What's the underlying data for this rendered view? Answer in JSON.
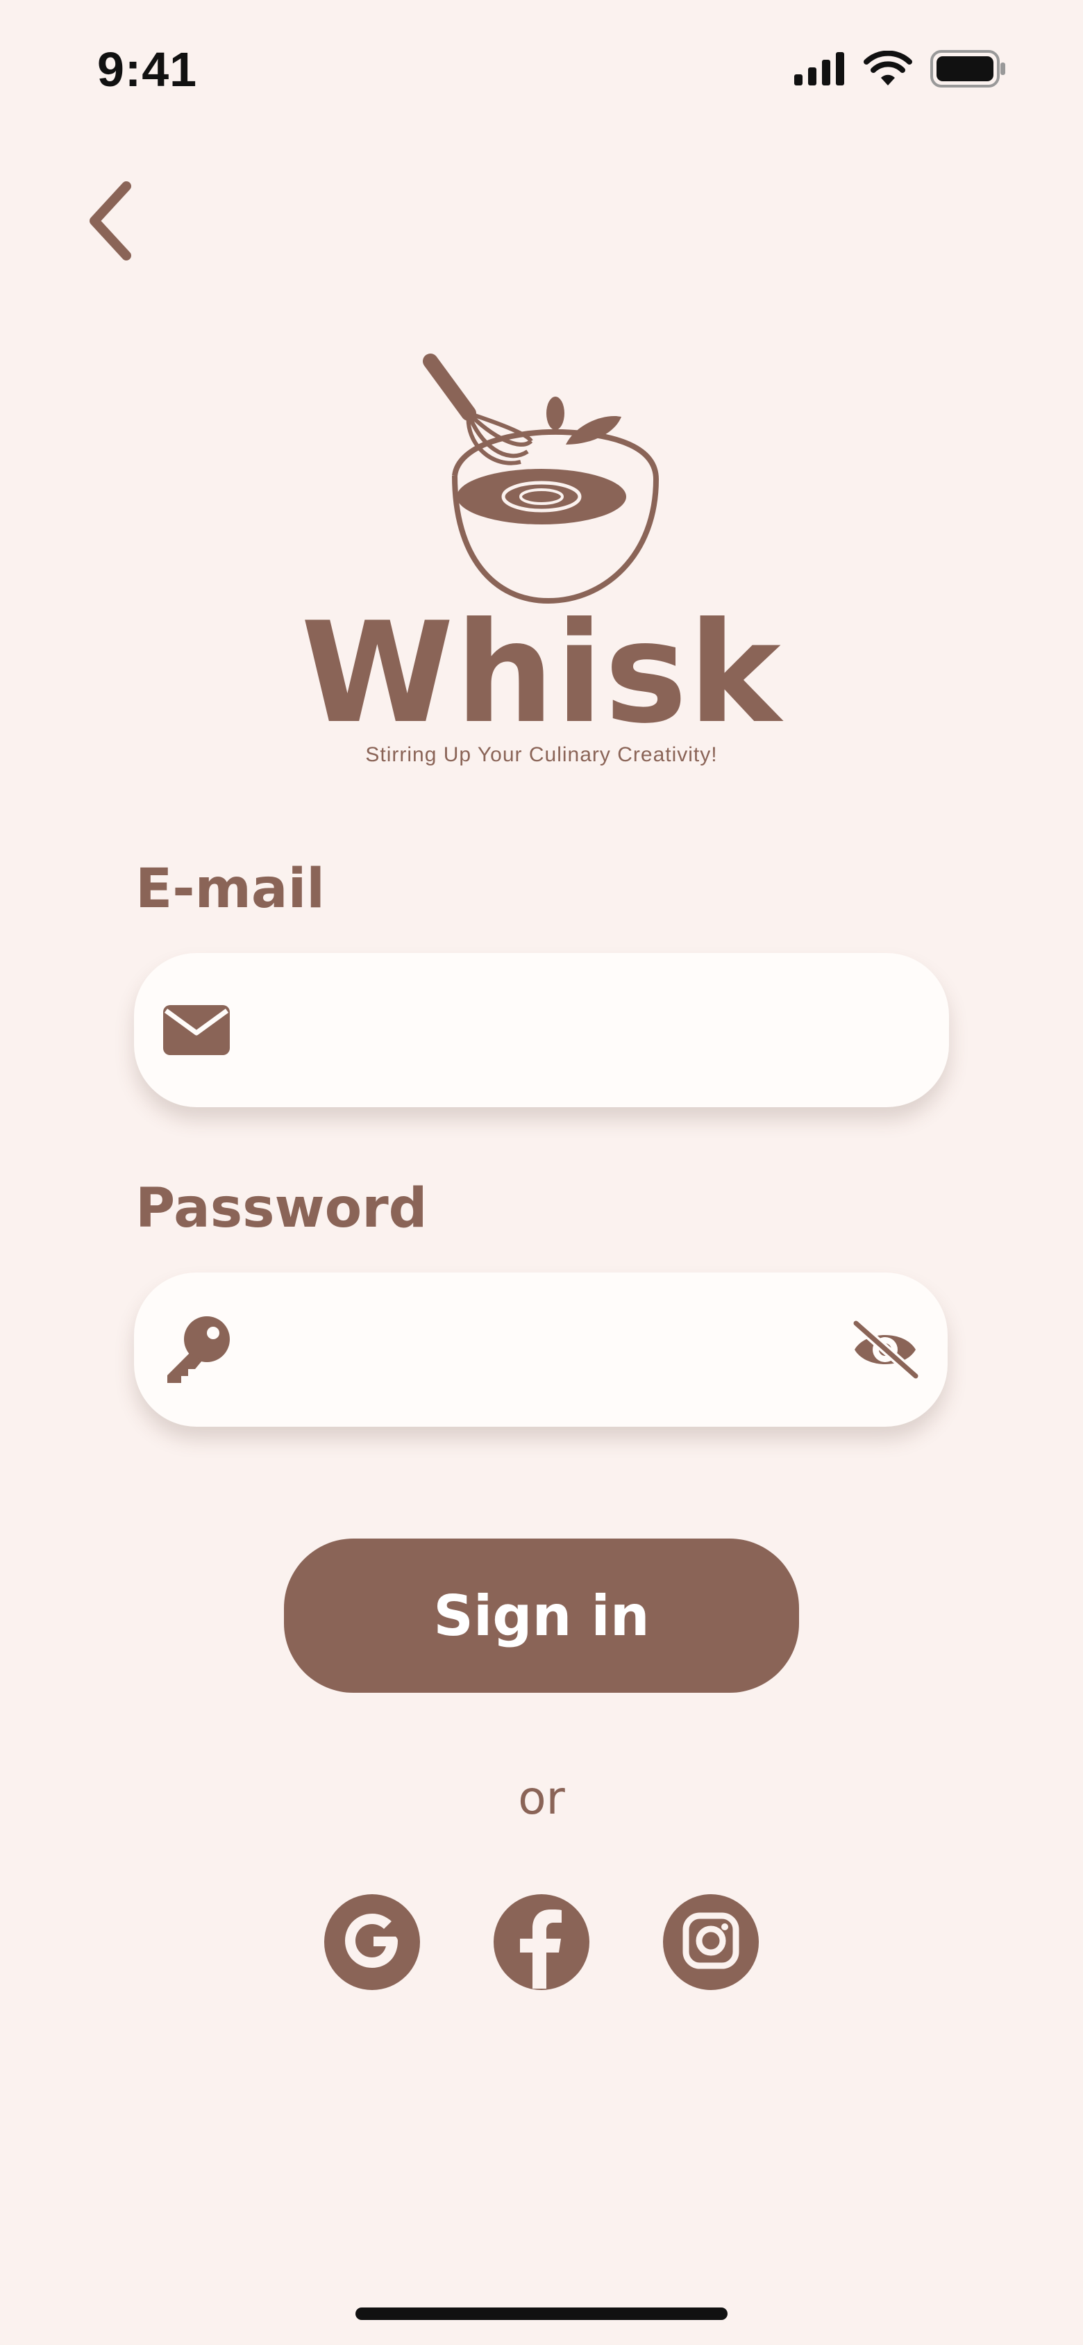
{
  "status_bar": {
    "time": "9:41",
    "icons": [
      "signal-icon",
      "wifi-icon",
      "battery-icon"
    ]
  },
  "navigation": {
    "back_icon": "chevron-left-icon"
  },
  "brand": {
    "logo_icon": "whisk-bowl-logo-icon",
    "title": "Whisk",
    "tagline": "Stirring Up Your Culinary Creativity!"
  },
  "form": {
    "email": {
      "label": "E-mail",
      "value": "",
      "placeholder": "",
      "icon": "envelope-icon"
    },
    "password": {
      "label": "Password",
      "value": "",
      "placeholder": "",
      "icon": "key-icon",
      "toggle_icon": "eye-slash-icon"
    },
    "submit_label": "Sign in"
  },
  "divider_text": "or",
  "social": [
    {
      "name": "google",
      "icon": "google-icon"
    },
    {
      "name": "facebook",
      "icon": "facebook-icon"
    },
    {
      "name": "instagram",
      "icon": "instagram-icon"
    }
  ],
  "colors": {
    "background": "#FBF2EF",
    "brand": "#8A6457",
    "input_bg": "#FFFCFA"
  }
}
